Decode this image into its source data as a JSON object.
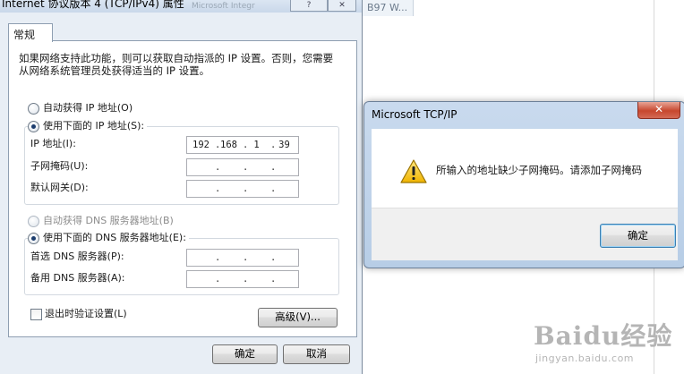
{
  "background": {
    "tab_label": "B97 W...",
    "ghost_text": "Microsoft Integr"
  },
  "properties_dialog": {
    "title": "Internet 协议版本 4 (TCP/IPv4) 属性",
    "tab": "常规",
    "intro": "如果网络支持此功能，则可以获取自动指派的 IP 设置。否则，您需要从网络系统管理员处获得适当的 IP 设置。",
    "auto_ip": "自动获得 IP 地址(O)",
    "manual_ip": "使用下面的 IP 地址(S):",
    "ip_label": "IP 地址(I):",
    "ip_value": [
      "192",
      "168",
      "1",
      "39"
    ],
    "subnet_label": "子网掩码(U):",
    "gateway_label": "默认网关(D):",
    "auto_dns": "自动获得 DNS 服务器地址(B)",
    "manual_dns": "使用下面的 DNS 服务器地址(E):",
    "preferred_dns_label": "首选 DNS 服务器(P):",
    "alternate_dns_label": "备用 DNS 服务器(A):",
    "validate_on_exit": "退出时验证设置(L)",
    "advanced_button": "高级(V)...",
    "ok_button": "确定",
    "cancel_button": "取消",
    "dot": "."
  },
  "message_box": {
    "title": "Microsoft TCP/IP",
    "close": "✕",
    "message": "所输入的地址缺少子网掩码。请添加子网掩码",
    "ok_button": "确定",
    "icon": "warning-icon",
    "icon_color": "#f2c200"
  },
  "watermark": {
    "brand": "Baidu经验",
    "url": "jingyan.baidu.com"
  }
}
